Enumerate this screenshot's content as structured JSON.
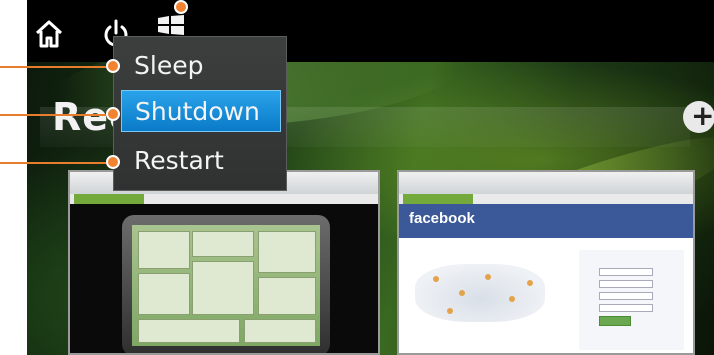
{
  "desktop": {
    "section_heading": "Rec"
  },
  "toolbar": {
    "home_icon": "home-icon",
    "power_icon": "power-icon",
    "windows_icon": "windows-icon"
  },
  "power_menu": {
    "items": [
      {
        "label": "Sleep",
        "selected": false
      },
      {
        "label": "Shutdown",
        "selected": true
      },
      {
        "label": "Restart",
        "selected": false
      }
    ]
  },
  "add_button": {
    "icon": "plus-icon",
    "label": "+"
  },
  "thumbnails": {
    "second": {
      "brand_text": "facebook"
    }
  },
  "colors": {
    "accent_selected": "#0a7bc8",
    "callout": "#f28331",
    "facebook_blue": "#3b5998"
  }
}
